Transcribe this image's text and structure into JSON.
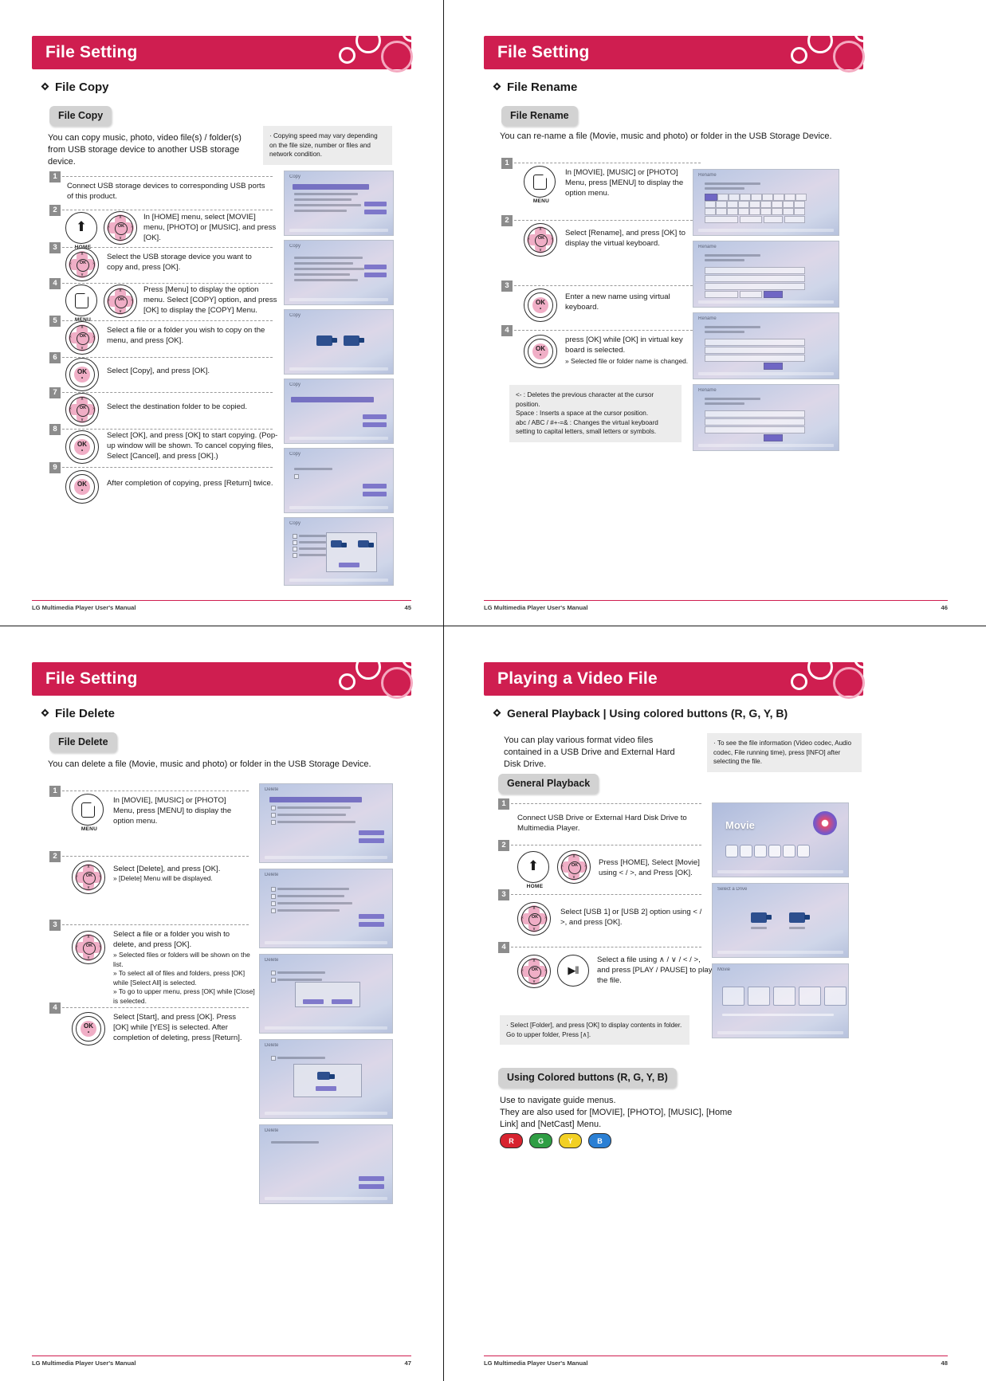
{
  "pages": [
    {
      "id": "p45",
      "banner_title": "File Setting",
      "section_heading": "File Copy",
      "pill": "File Copy",
      "intro": "You can copy music, photo, video file(s) / folder(s) from USB storage device to another USB storage device.",
      "note": "· Copying speed may vary depending on the file size, number or files and network condition.",
      "steps": [
        {
          "num": "1",
          "icons": [],
          "text": "Connect USB storage devices to corresponding USB ports of this product."
        },
        {
          "num": "2",
          "icons": [
            "home-key",
            "nav-key"
          ],
          "text": "In [HOME] menu, select [MOVIE] menu, [PHOTO] or [MUSIC], and press [OK]."
        },
        {
          "num": "3",
          "icons": [
            "nav-key"
          ],
          "text": "Select the USB storage device you want to copy and, press [OK]."
        },
        {
          "num": "4",
          "icons": [
            "menu-key",
            "nav-key"
          ],
          "text": "Press [Menu] to display the option menu. Select [COPY] option, and press [OK] to display the [COPY] Menu."
        },
        {
          "num": "5",
          "icons": [
            "nav-key"
          ],
          "text": "Select a file or a folder you wish to copy on the menu, and press [OK]."
        },
        {
          "num": "6",
          "icons": [
            "ok-key"
          ],
          "text": "Select [Copy], and press [OK]."
        },
        {
          "num": "7",
          "icons": [
            "nav-key"
          ],
          "text": "Select the destination folder to be copied."
        },
        {
          "num": "8",
          "icons": [
            "ok-key"
          ],
          "text": "Select [OK], and press [OK] to start copying. (Pop-up window will be shown. To cancel copying files, Select [Cancel], and press [OK].)"
        },
        {
          "num": "9",
          "icons": [
            "ok-key"
          ],
          "text": "After completion of copying, press [Return] twice."
        }
      ],
      "screens": [
        {
          "label": "Copy"
        },
        {
          "label": "Copy"
        },
        {
          "label": "Copy"
        },
        {
          "label": "Copy"
        },
        {
          "label": "Copy"
        },
        {
          "label": "Copy"
        }
      ],
      "footer_left": "LG Multimedia Player User's Manual",
      "footer_right": "45"
    },
    {
      "id": "p46",
      "banner_title": "File Setting",
      "section_heading": "File Rename",
      "pill": "File Rename",
      "intro": "You can re-name a file (Movie, music and photo) or folder in the USB Storage Device.",
      "steps": [
        {
          "num": "1",
          "icons": [
            "menu-key"
          ],
          "text": "In [MOVIE], [MUSIC] or [PHOTO] Menu, press [MENU] to display the option menu."
        },
        {
          "num": "2",
          "icons": [
            "nav-key"
          ],
          "text": "Select [Rename], and press [OK] to display the virtual keyboard."
        },
        {
          "num": "3",
          "icons": [
            "ok-key"
          ],
          "text": "Enter a new name using virtual keyboard."
        },
        {
          "num": "4",
          "icons": [
            "ok-key"
          ],
          "text": "press [OK] while [OK] in virtual key board is selected.",
          "sub": "» Selected file or folder name is changed."
        }
      ],
      "note": "<- : Deletes the previous character at the cursor position.\nSpace : Inserts a space at the cursor position.\nabc / ABC / #+-=& : Changes the virtual keyboard setting to capital letters, small letters or symbols.",
      "screens": [
        {
          "label": "Rename"
        },
        {
          "label": "Rename"
        },
        {
          "label": "Rename"
        },
        {
          "label": "Rename"
        }
      ],
      "footer_left": "LG Multimedia Player User's Manual",
      "footer_right": "46"
    },
    {
      "id": "p47",
      "banner_title": "File Setting",
      "section_heading": "File Delete",
      "pill": "File Delete",
      "intro": "You can delete a file (Movie, music and photo) or folder in the USB Storage Device.",
      "steps": [
        {
          "num": "1",
          "icons": [
            "menu-key"
          ],
          "text": "In [MOVIE], [MUSIC] or [PHOTO] Menu, press [MENU] to display the option menu."
        },
        {
          "num": "2",
          "icons": [
            "nav-key"
          ],
          "text": "Select [Delete], and press [OK].",
          "sub": "» [Delete] Menu will be displayed."
        },
        {
          "num": "3",
          "icons": [
            "nav-key"
          ],
          "text": "Select a file or a folder you wish to delete, and press [OK].",
          "sub": "» Selected files or folders will be shown on the list.\n» To select all of files and folders, press [OK] while [Select All] is selected.\n» To go to upper menu, press [OK] while [Close] is selected."
        },
        {
          "num": "4",
          "icons": [
            "ok-key"
          ],
          "text": "Select [Start], and press [OK]. Press [OK] while [YES] is selected. After completion of deleting, press [Return]."
        }
      ],
      "screens": [
        {
          "label": "Delete"
        },
        {
          "label": "Delete"
        },
        {
          "label": "Delete"
        },
        {
          "label": "Delete"
        },
        {
          "label": "Delete"
        }
      ],
      "footer_left": "LG Multimedia Player User's Manual",
      "footer_right": "47"
    },
    {
      "id": "p48",
      "banner_title": "Playing a Video File",
      "section_heading": "General Playback | Using colored buttons (R, G, Y, B)",
      "intro": "You can play various format video files contained in a USB Drive and External Hard Disk Drive.",
      "note": "· To see the file information (Video codec, Audio codec, File running time), press [INFO] after selecting the file.",
      "pill": "General Playback",
      "steps": [
        {
          "num": "1",
          "icons": [],
          "text": "Connect USB Drive or External Hard Disk Drive to Multimedia Player."
        },
        {
          "num": "2",
          "icons": [
            "home-key",
            "nav-key"
          ],
          "text": "Press [HOME], Select [Movie] using < / >, and Press [OK]."
        },
        {
          "num": "3",
          "icons": [
            "nav-key"
          ],
          "text": "Select [USB 1] or [USB 2] option using < / >, and press [OK]."
        },
        {
          "num": "4",
          "icons": [
            "nav-key",
            "play-key"
          ],
          "text": "Select a file using ∧ / ∨ / < / >, and press [PLAY / PAUSE] to play the file."
        }
      ],
      "note2": "· Select [Folder], and press [OK] to display contents in folder. Go to upper folder, Press [∧].",
      "pill2": "Using Colored buttons (R, G, Y, B)",
      "para2": "Use to navigate guide menus.\nThey are also used for [MOVIE], [PHOTO], [MUSIC], [Home Link] and [NetCast] Menu.",
      "color_buttons": [
        {
          "letter": "R",
          "color": "#d8232f"
        },
        {
          "letter": "G",
          "color": "#2f9e44"
        },
        {
          "letter": "Y",
          "color": "#f2d024"
        },
        {
          "letter": "B",
          "color": "#2a7fd4"
        }
      ],
      "screens": [
        {
          "label": "Movie"
        },
        {
          "label": "Select a Drive"
        },
        {
          "label": "Movie"
        }
      ],
      "footer_left": "LG Multimedia Player User's Manual",
      "footer_right": "48"
    }
  ],
  "colors": {
    "brand": "#cf1e50",
    "pill_bg": "#d2d2d2",
    "step_num_bg": "#8c8c8c"
  }
}
